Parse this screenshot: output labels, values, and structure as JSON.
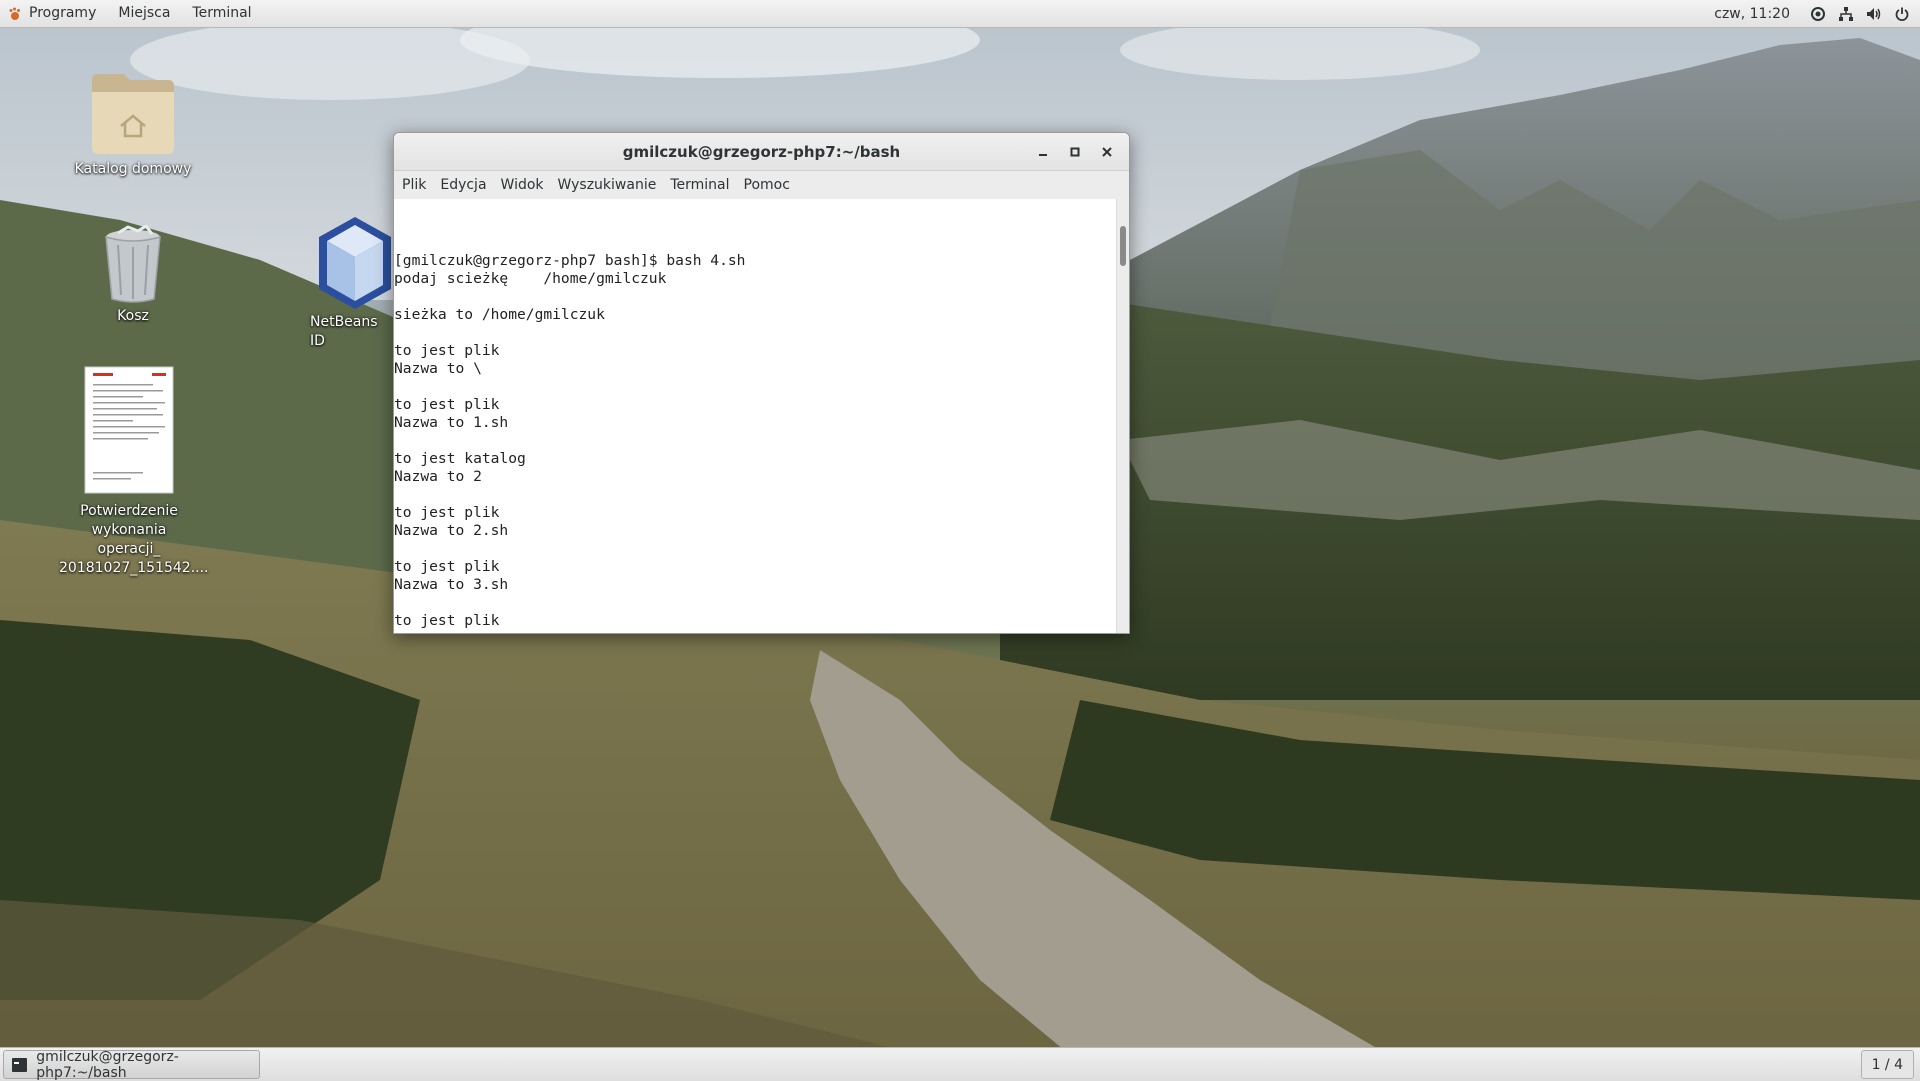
{
  "top_panel": {
    "apps_menu": "Programy",
    "places_menu": "Miejsca",
    "app_menu": "Terminal",
    "clock": "czw, 11:20",
    "tray_icons": [
      "accessibility-icon",
      "network-icon",
      "volume-icon",
      "power-icon"
    ]
  },
  "desktop": {
    "icons": [
      {
        "label": "Katalog domowy",
        "icon": "home-folder-icon"
      },
      {
        "label": "Kosz",
        "icon": "trash-icon"
      },
      {
        "label": "NetBeans ID",
        "icon": "netbeans-icon"
      },
      {
        "label_lines": [
          "Potwierdzenie",
          "wykonania operacji_",
          "20181027_151542...."
        ],
        "icon": "pdf-document-icon"
      }
    ]
  },
  "terminal_window": {
    "title": "gmilczuk@grzegorz-php7:~/bash",
    "menu": [
      "Plik",
      "Edycja",
      "Widok",
      "Wyszukiwanie",
      "Terminal",
      "Pomoc"
    ],
    "lines": [
      "[gmilczuk@grzegorz-php7 bash]$ bash 4.sh",
      "podaj scieżkę    /home/gmilczuk",
      "",
      "sieżka to /home/gmilczuk",
      "",
      "to jest plik",
      "Nazwa to \\",
      "",
      "to jest plik",
      "Nazwa to 1.sh",
      "",
      "to jest katalog",
      "Nazwa to 2",
      "",
      "to jest plik",
      "Nazwa to 2.sh",
      "",
      "to jest plik",
      "Nazwa to 3.sh",
      "",
      "to jest plik"
    ]
  },
  "bottom_panel": {
    "task_label": "gmilczuk@grzegorz-php7:~/bash",
    "workspace": "1 / 4"
  }
}
